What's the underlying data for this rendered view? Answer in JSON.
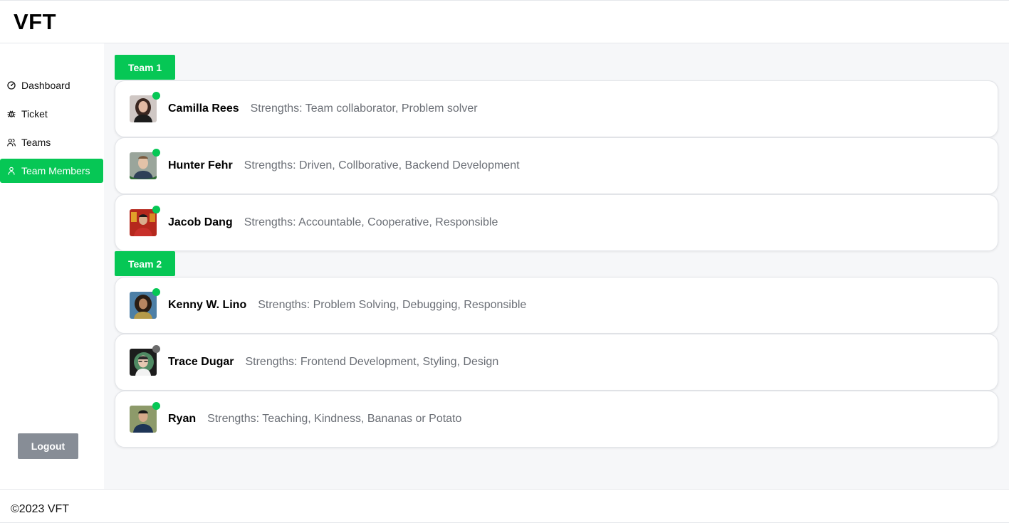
{
  "app": {
    "logo": "VFT"
  },
  "sidebar": {
    "items": [
      {
        "label": "Dashboard",
        "icon": "dashboard-gauge-icon",
        "active": false
      },
      {
        "label": "Ticket",
        "icon": "bug-icon",
        "active": false
      },
      {
        "label": "Teams",
        "icon": "users-icon",
        "active": false
      },
      {
        "label": "Team Members",
        "icon": "user-icon",
        "active": true
      }
    ],
    "logout_label": "Logout"
  },
  "teams": [
    {
      "label": "Team 1",
      "members": [
        {
          "name": "Camilla Rees",
          "strengths": "Strengths: Team collaborator, Problem solver",
          "status": "online"
        },
        {
          "name": "Hunter Fehr",
          "strengths": "Strengths: Driven, Collborative, Backend Development",
          "status": "online"
        },
        {
          "name": "Jacob Dang",
          "strengths": "Strengths: Accountable, Cooperative, Responsible",
          "status": "online"
        }
      ]
    },
    {
      "label": "Team 2",
      "members": [
        {
          "name": "Kenny W. Lino",
          "strengths": "Strengths: Problem Solving, Debugging, Responsible",
          "status": "online"
        },
        {
          "name": "Trace Dugar",
          "strengths": "Strengths: Frontend Development, Styling, Design",
          "status": "offline"
        },
        {
          "name": "Ryan",
          "strengths": "Strengths: Teaching, Kindness, Bananas or Potato",
          "status": "online"
        }
      ]
    }
  ],
  "footer": {
    "copyright": "©2023 VFT"
  },
  "colors": {
    "accent": "#06c755",
    "online": "#06c755",
    "offline": "#6b6b6b",
    "logout_bg": "#878d96"
  }
}
